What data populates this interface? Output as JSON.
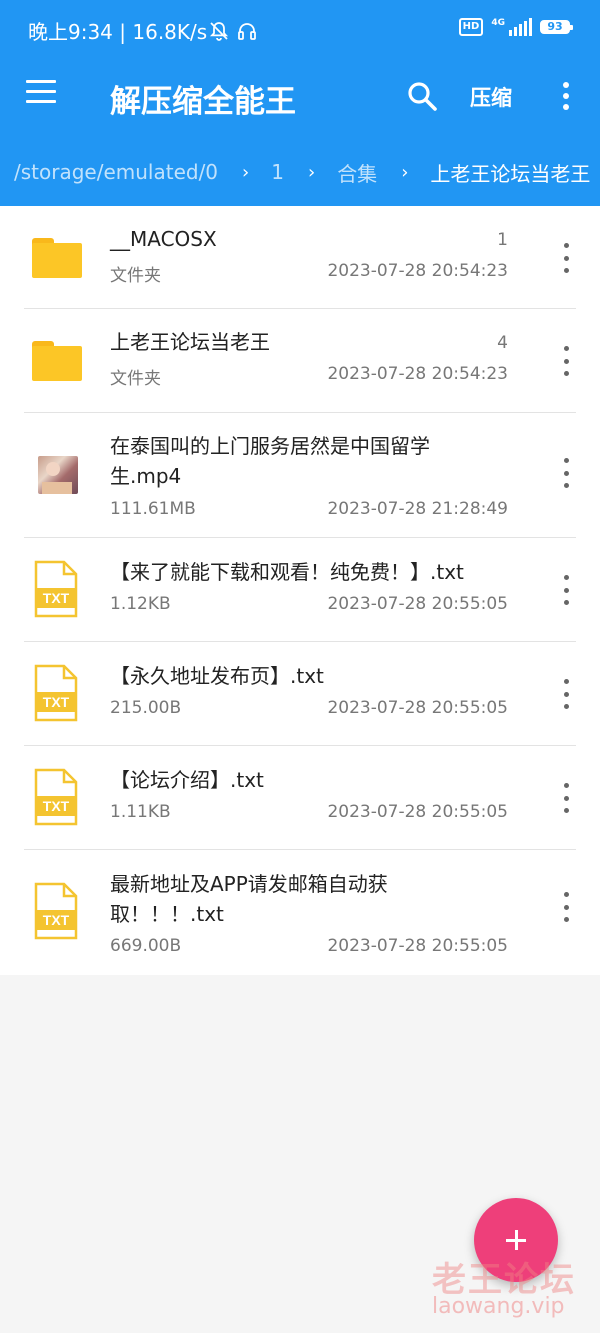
{
  "status_bar": {
    "text": "晚上9:34 | 16.8K/s",
    "hd": "HD",
    "network": "4G",
    "battery": "93"
  },
  "toolbar": {
    "menu_icon": "menu-icon",
    "title": "解压缩全能王",
    "search_icon": "search-icon",
    "compress_label": "压缩",
    "more_icon": "more-vert-icon"
  },
  "breadcrumb": [
    "/storage/emulated/0",
    "1",
    "合集",
    "上老王论坛当老王"
  ],
  "files": [
    {
      "icon": "folder-icon",
      "name": "__MACOSX",
      "meta": "文件夹",
      "count": "1",
      "date": "2023-07-28 20:54:23"
    },
    {
      "icon": "folder-icon",
      "name": "上老王论坛当老王",
      "meta": "文件夹",
      "count": "4",
      "date": "2023-07-28 20:54:23"
    },
    {
      "icon": "video-thumbnail",
      "name": "在泰国叫的上门服务居然是中国留学生.mp4",
      "meta": "111.61MB",
      "count": "",
      "date": "2023-07-28 21:28:49"
    },
    {
      "icon": "txt-file-icon",
      "icon_label": "TXT",
      "name": "【来了就能下载和观看！纯免费！】.txt",
      "meta": "1.12KB",
      "count": "",
      "date": "2023-07-28 20:55:05"
    },
    {
      "icon": "txt-file-icon",
      "icon_label": "TXT",
      "name": "【永久地址发布页】.txt",
      "meta": "215.00B",
      "count": "",
      "date": "2023-07-28 20:55:05"
    },
    {
      "icon": "txt-file-icon",
      "icon_label": "TXT",
      "name": "【论坛介绍】.txt",
      "meta": "1.11KB",
      "count": "",
      "date": "2023-07-28 20:55:05"
    },
    {
      "icon": "txt-file-icon",
      "icon_label": "TXT",
      "name": "最新地址及APP请发邮箱自动获取！！！.txt",
      "meta": "669.00B",
      "count": "",
      "date": "2023-07-28 20:55:05"
    }
  ],
  "fab": {
    "icon": "plus-icon"
  },
  "watermark": {
    "cn": "老王论坛",
    "url": "laowang.vip"
  },
  "colors": {
    "primary": "#2196f3",
    "fab": "#ee3f7a",
    "folder": "#fcc626",
    "txt": "#f4c430"
  }
}
